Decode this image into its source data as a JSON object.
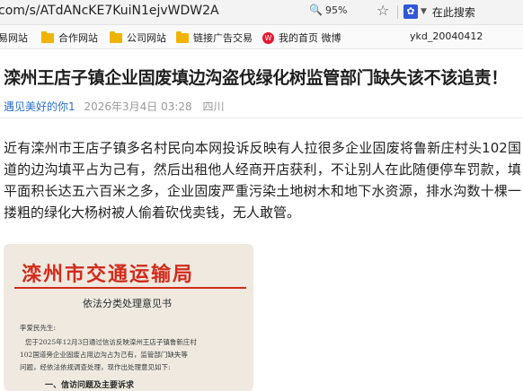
{
  "browser": {
    "url": "com/s/ATdANcKE7KuiN1ejvWDW2A",
    "zoom": "95%",
    "search_text": "在此搜索"
  },
  "bookmarks": {
    "items": [
      "易网站",
      "合作网站",
      "公司网站",
      "链接广告交易",
      "我的首页 微博"
    ],
    "right_text": "ykd_20040412"
  },
  "article": {
    "title": "滦州王店子镇企业固废填边沟盗伐绿化树监管部门缺失该不该追责！",
    "author": "遇见美好的你1",
    "date": "2026年3月4日 03:28",
    "location": "四川",
    "body": "近有滦州市王店子镇多名村民向本网投诉反映有人拉很多企业固废将鲁新庄村头102国道的边沟填平占为己有，然后出租他人经商开店获利，不让别人在此随便停车罚款，填平面积长达五六百米之多，企业固废严重污染土地树木和地下水资源，排水沟数十棵一搂粗的绿化大杨树被人偷着砍伐卖钱，无人敢管。"
  },
  "document": {
    "header": "滦州市交通运输局",
    "subtitle": "依法分类处理意见书",
    "greeting": "李爱民先生:",
    "line1": "您于2025年12月3日通过信访反映滦州王店子镇鲁新庄村",
    "line2": "102国道旁企业固废占用边沟占为己有，监管部门缺失等",
    "line3": "问题，经依法依规调查处理，现作出处理意见如下:",
    "line4": "一、信访问题及主要诉求"
  },
  "colors": {
    "author_link": "#2a6fd3",
    "doc_red": "#d22b1c",
    "folder": "#f0b400"
  }
}
